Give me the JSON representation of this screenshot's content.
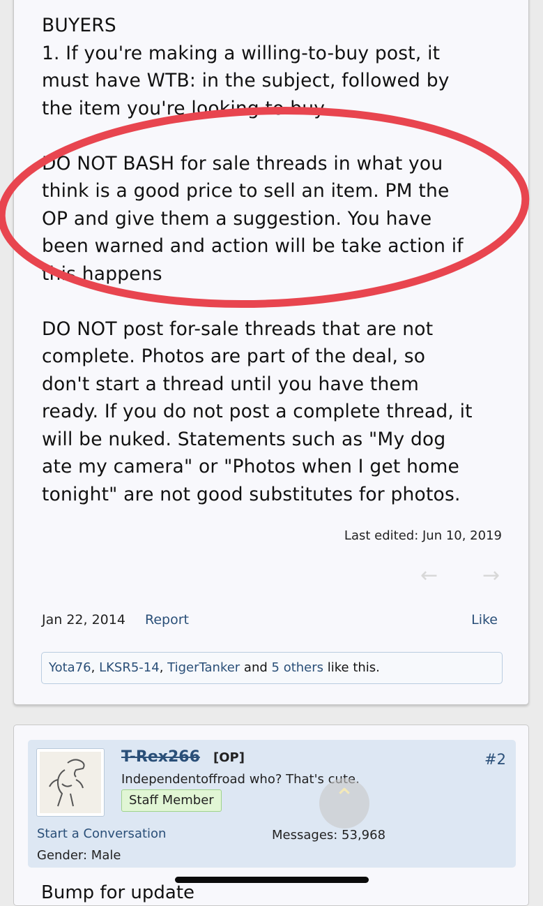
{
  "post1": {
    "paragraphs": [
      [
        "BUYERS",
        "1. If you're making a willing-to-buy post, it",
        "must have WTB: in the subject, followed by",
        "the item you're looking to buy"
      ],
      [
        "DO NOT BASH for sale threads in what you",
        "think is a good price to sell an item. PM the",
        "OP and give them a suggestion. You have",
        "been warned and action will be take action if",
        "this happens"
      ],
      [
        "DO NOT post for-sale threads that are not",
        "complete. Photos are part of the deal, so",
        "don't start a thread until you have them",
        "ready. If you do not post a complete thread, it",
        "will be nuked. Statements such as \"My dog",
        "ate my camera\" or \"Photos when I get home",
        "tonight\" are not good substitutes for photos."
      ]
    ],
    "last_edited": "Last edited: Jun 10, 2019",
    "date": "Jan 22, 2014",
    "report_label": "Report",
    "like_label": "Like",
    "likes": {
      "user1": "Yota76",
      "sep1": ", ",
      "user2": "LKSR5-14",
      "sep2": ", ",
      "user3": "TigerTanker",
      "mid": " and ",
      "others": "5 others",
      "tail": " like this."
    },
    "annotation_color": "#e8454f"
  },
  "post2": {
    "username": "T-Rex266",
    "op_badge": "[OP]",
    "post_number": "#2",
    "user_title": "Independentoffroad who? That's cute.",
    "staff_badge": "Staff Member",
    "conversation_link": "Start a Conversation",
    "gender": "Gender: Male",
    "messages": "Messages: 53,968",
    "body_start": "Bump for update"
  }
}
